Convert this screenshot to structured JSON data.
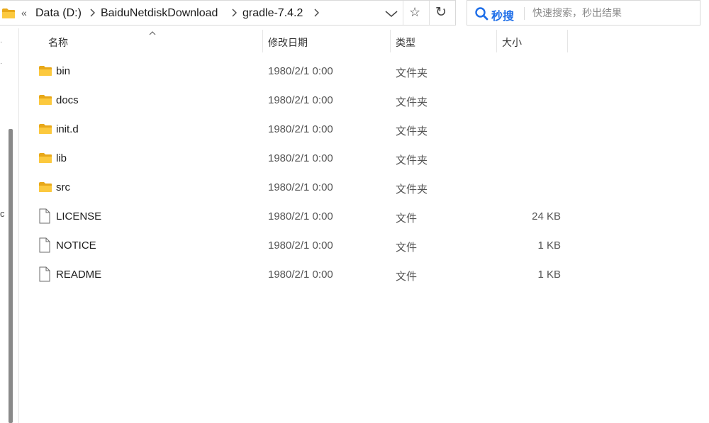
{
  "address_bar": {
    "overflow_glyph": "«",
    "breadcrumbs": [
      "Data (D:)",
      "BaiduNetdiskDownload",
      "gradle-7.4.2"
    ],
    "dropdown_icon": "chevron-down-icon",
    "favorite_icon": "star-icon",
    "refresh_icon": "refresh-icon",
    "favorite_glyph": "☆",
    "refresh_glyph": "↻"
  },
  "search": {
    "brand": "秒搜",
    "placeholder": "快速搜索，秒出结果",
    "accent_color": "#1e6ee8"
  },
  "columns": {
    "name": "名称",
    "date": "修改日期",
    "type": "类型",
    "size": "大小"
  },
  "files": [
    {
      "name": "bin",
      "date": "1980/2/1 0:00",
      "type": "文件夹",
      "size": "",
      "icon": "folder-icon"
    },
    {
      "name": "docs",
      "date": "1980/2/1 0:00",
      "type": "文件夹",
      "size": "",
      "icon": "folder-icon"
    },
    {
      "name": "init.d",
      "date": "1980/2/1 0:00",
      "type": "文件夹",
      "size": "",
      "icon": "folder-icon"
    },
    {
      "name": "lib",
      "date": "1980/2/1 0:00",
      "type": "文件夹",
      "size": "",
      "icon": "folder-icon"
    },
    {
      "name": "src",
      "date": "1980/2/1 0:00",
      "type": "文件夹",
      "size": "",
      "icon": "folder-icon"
    },
    {
      "name": "LICENSE",
      "date": "1980/2/1 0:00",
      "type": "文件",
      "size": "24 KB",
      "icon": "file-icon"
    },
    {
      "name": "NOTICE",
      "date": "1980/2/1 0:00",
      "type": "文件",
      "size": "1 KB",
      "icon": "file-icon"
    },
    {
      "name": "README",
      "date": "1980/2/1 0:00",
      "type": "文件",
      "size": "1 KB",
      "icon": "file-icon"
    }
  ],
  "nav": {
    "partial_glyph": "c"
  }
}
